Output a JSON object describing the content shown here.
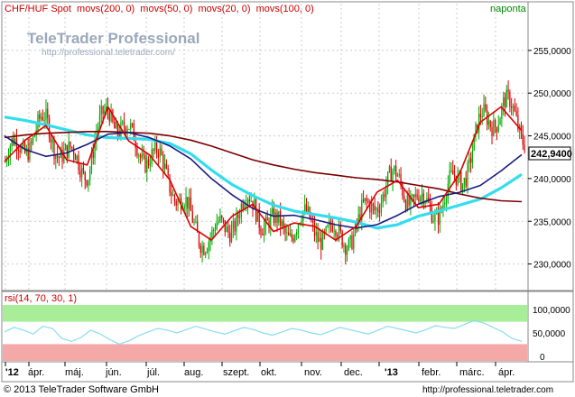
{
  "header": {
    "instrument": "CHF/HUF Spot",
    "indicators": [
      "movs(200, 0)",
      "movs(50, 0)",
      "movs(20, 0)",
      "movs(100, 0)"
    ],
    "period": "naponta"
  },
  "watermark": {
    "brand": "TeleTrader Professional",
    "url": "http://professional.teletrader.com/"
  },
  "rsi_panel": {
    "title": "rsi(14, 70, 30, 1)",
    "y_ticks": [
      "100,0000",
      "50,0000",
      "0"
    ],
    "overbought": 70,
    "oversold": 30
  },
  "price_axis": {
    "ticks": [
      "255,0000",
      "250,0000",
      "245,0000",
      "240,0000",
      "235,0000",
      "230,0000"
    ],
    "last_label": "242,9400"
  },
  "x_axis": {
    "labels": [
      "'12",
      "ápr.",
      "máj.",
      "jún.",
      "júl.",
      "aug.",
      "szept.",
      "okt.",
      "nov.",
      "dec.",
      "'13",
      "febr.",
      "márc.",
      "ápr."
    ]
  },
  "footer": {
    "copyright": "© 2013 TeleTrader Software GmbH",
    "url": "http://professional.teletrader.com"
  },
  "colors": {
    "candle_up": "#00aa00",
    "candle_down": "#dd0000",
    "ma200": "#7a0000",
    "ma50": "#1a1a80",
    "ma20": "#dd0000",
    "ma100": "#33ddee",
    "rsi_line": "#88ddee",
    "rsi_overbought_zone": "#a8ee98",
    "rsi_oversold_zone": "#f5a8a8",
    "title_text": "#cc0000",
    "period_text": "#008800"
  },
  "chart_data": [
    {
      "type": "candlestick",
      "title": "CHF/HUF Spot",
      "ylim": [
        227,
        259
      ],
      "y_ticks": [
        230,
        235,
        240,
        245,
        250,
        255
      ],
      "last_value": 242.94,
      "series": [
        {
          "name": "movs(200, 0)",
          "values": [
            244.8,
            245.1,
            245.3,
            245.4,
            245.5,
            245.5,
            245.4,
            245.3,
            245.0,
            244.5,
            243.8,
            243.0,
            242.2,
            241.6,
            241.1,
            240.7,
            240.4,
            240.1,
            239.9,
            239.6,
            239.2,
            238.8,
            238.2,
            237.7,
            237.4,
            237.3
          ]
        },
        {
          "name": "movs(50, 0)",
          "values": [
            245.0,
            243.4,
            242.6,
            243.0,
            244.0,
            245.2,
            245.4,
            244.8,
            243.8,
            242.3,
            240.0,
            238.1,
            236.5,
            235.6,
            235.7,
            235.2,
            234.6,
            234.2,
            234.6,
            235.7,
            237.0,
            237.9,
            238.4,
            239.2,
            240.9,
            242.8
          ]
        },
        {
          "name": "movs(20, 0)",
          "values": [
            242.0,
            244.5,
            246.2,
            242.2,
            241.6,
            248.4,
            244.4,
            242.8,
            239.8,
            234.4,
            232.8,
            235.6,
            237.0,
            233.8,
            234.8,
            234.4,
            232.8,
            234.4,
            238.4,
            239.8,
            236.6,
            237.0,
            240.6,
            246.6,
            248.4,
            245.6
          ]
        },
        {
          "name": "movs(100, 0)",
          "values": [
            247.2,
            246.8,
            246.3,
            245.7,
            245.1,
            244.8,
            244.7,
            244.6,
            244.1,
            242.9,
            241.0,
            239.3,
            238.0,
            236.9,
            236.2,
            235.8,
            235.4,
            234.9,
            234.2,
            234.6,
            235.6,
            236.2,
            236.9,
            237.6,
            238.9,
            240.5
          ]
        }
      ]
    },
    {
      "type": "line",
      "title": "rsi(14, 70, 30, 1)",
      "ylim": [
        0,
        100
      ],
      "series": [
        {
          "name": "rsi(14, 70, 30, 1)",
          "values": [
            52,
            60,
            55,
            48,
            62,
            58,
            40,
            35,
            42,
            55,
            48,
            38,
            30,
            36,
            45,
            52,
            58,
            55,
            50,
            56,
            62,
            57,
            52,
            48,
            54,
            60,
            56,
            50,
            46,
            52,
            58,
            55,
            50,
            47,
            53,
            60,
            56,
            52,
            48,
            55,
            62,
            58,
            54,
            50,
            56,
            63,
            60,
            58,
            65,
            72,
            68,
            60,
            52,
            40,
            35
          ]
        }
      ]
    }
  ]
}
